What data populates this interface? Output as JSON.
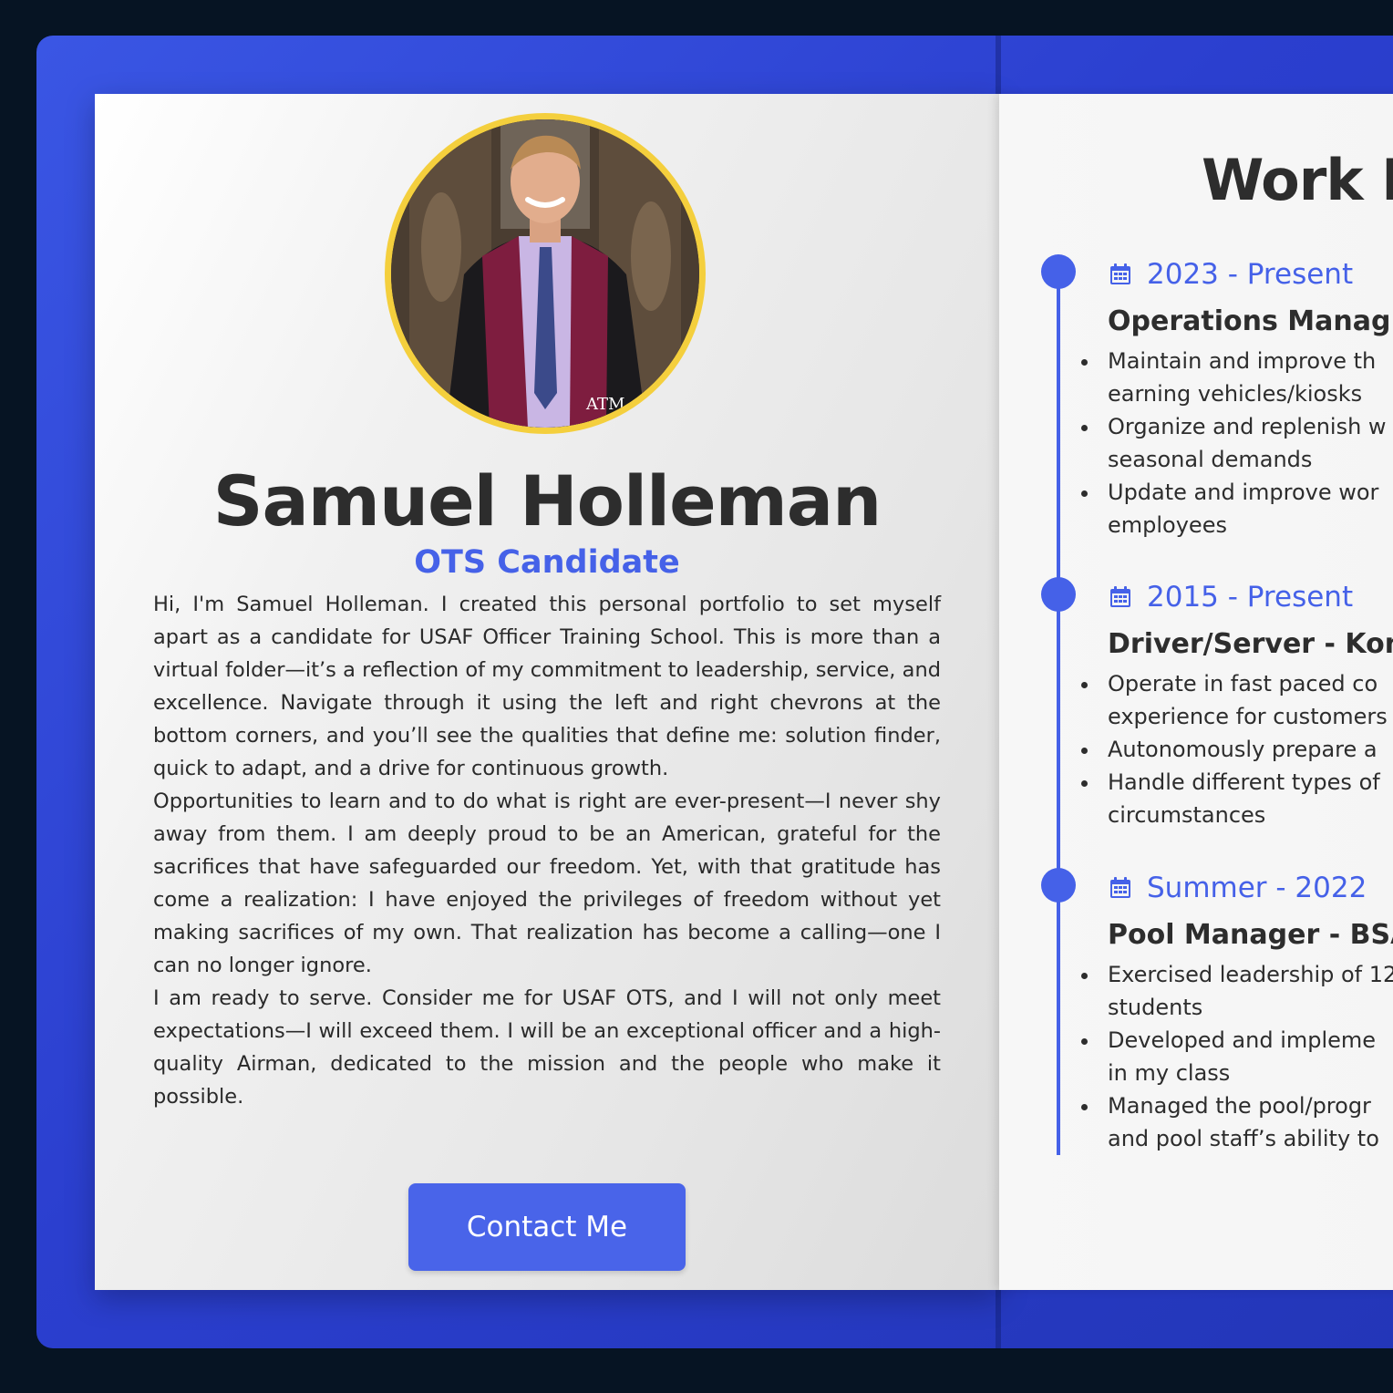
{
  "colors": {
    "background": "#061423",
    "book_cover": "#3a56e4",
    "accent": "#4561e8",
    "avatar_ring": "#f4cf3d",
    "text": "#2d2d2d"
  },
  "profile": {
    "name": "Samuel Holleman",
    "role": "OTS Candidate",
    "bio": [
      "Hi, I'm Samuel Holleman. I created this personal portfolio to set myself apart as a candidate for USAF Officer Training School. This is more than a virtual folder—it’s a reflection of my commitment to leadership, service, and excellence. Navigate through it using the left and right chevrons at the bottom corners, and you’ll see the qualities that define me: solution finder, quick to adapt, and a drive for continuous growth.",
      "Opportunities to learn and to do what is right are ever-present—I never shy away from them. I am deeply proud to be an American, grateful for the sacrifices that have safeguarded our freedom. Yet, with that gratitude has come a realization: I have enjoyed the privileges of freedom without yet making sacrifices of my own. That realization has become a calling—one I can no longer ignore.",
      "I am ready to serve. Consider me for USAF OTS, and I will not only meet expectations—I will exceed them. I will be an exceptional officer and a high-quality Airman, dedicated to the mission and the people who make it possible."
    ],
    "contact_label": "Contact Me"
  },
  "work": {
    "title": "Work E",
    "entries": [
      {
        "date": "2023 - Present",
        "job": "Operations Manag",
        "bullets": [
          "Maintain and improve th\nearning vehicles/kiosks",
          "Organize and replenish w\nseasonal demands",
          "Update and improve wor\nemployees"
        ]
      },
      {
        "date": "2015 - Present",
        "job": "Driver/Server - Kon",
        "bullets": [
          "Operate in fast paced co\nexperience for customers",
          "Autonomously prepare a",
          "Handle different types of\ncircumstances"
        ]
      },
      {
        "date": "Summer - 2022",
        "job": "Pool Manager - BSA",
        "bullets": [
          "Exercised leadership of 12\nstudents",
          "Developed and impleme\nin my class",
          "Managed the pool/progr\nand pool staff’s ability to"
        ]
      }
    ]
  }
}
